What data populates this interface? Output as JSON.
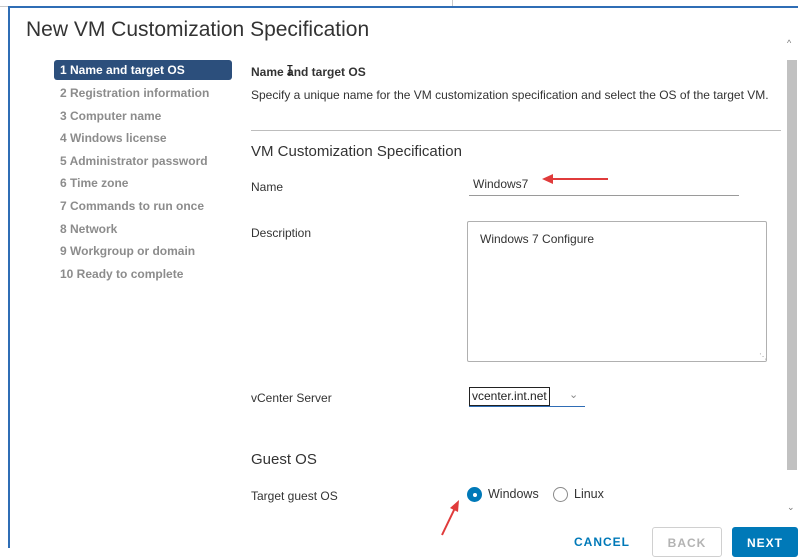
{
  "dialog": {
    "title": "New VM Customization Specification"
  },
  "steps": [
    "1 Name and target OS",
    "2 Registration information",
    "3 Computer name",
    "4 Windows license",
    "5 Administrator password",
    "6 Time zone",
    "7 Commands to run once",
    "8 Network",
    "9 Workgroup or domain",
    "10 Ready to complete"
  ],
  "active_step_index": 0,
  "content": {
    "title": "Name and target OS",
    "description": "Specify a unique name for the VM customization specification and select the OS of the target VM.",
    "spec_heading": "VM Customization Specification",
    "name_label": "Name",
    "name_value": "Windows7",
    "description_label": "Description",
    "description_value": "Windows 7 Configure",
    "vcenter_label": "vCenter Server",
    "vcenter_value": "vcenter.int.net",
    "guest_os_heading": "Guest OS",
    "target_os_label": "Target guest OS",
    "os_options": [
      "Windows",
      "Linux"
    ],
    "os_selected": "Windows"
  },
  "footer": {
    "cancel": "CANCEL",
    "back": "BACK",
    "next": "NEXT"
  },
  "colors": {
    "accent": "#0079b8",
    "active_step": "#2c4f7c",
    "annotation_arrow": "#e03b3b",
    "dialog_border": "#2f6db5"
  },
  "icons": {
    "dropdown": "chevron-down-icon",
    "scroll_up": "scroll-up-icon",
    "scroll_down": "scroll-down-icon"
  }
}
